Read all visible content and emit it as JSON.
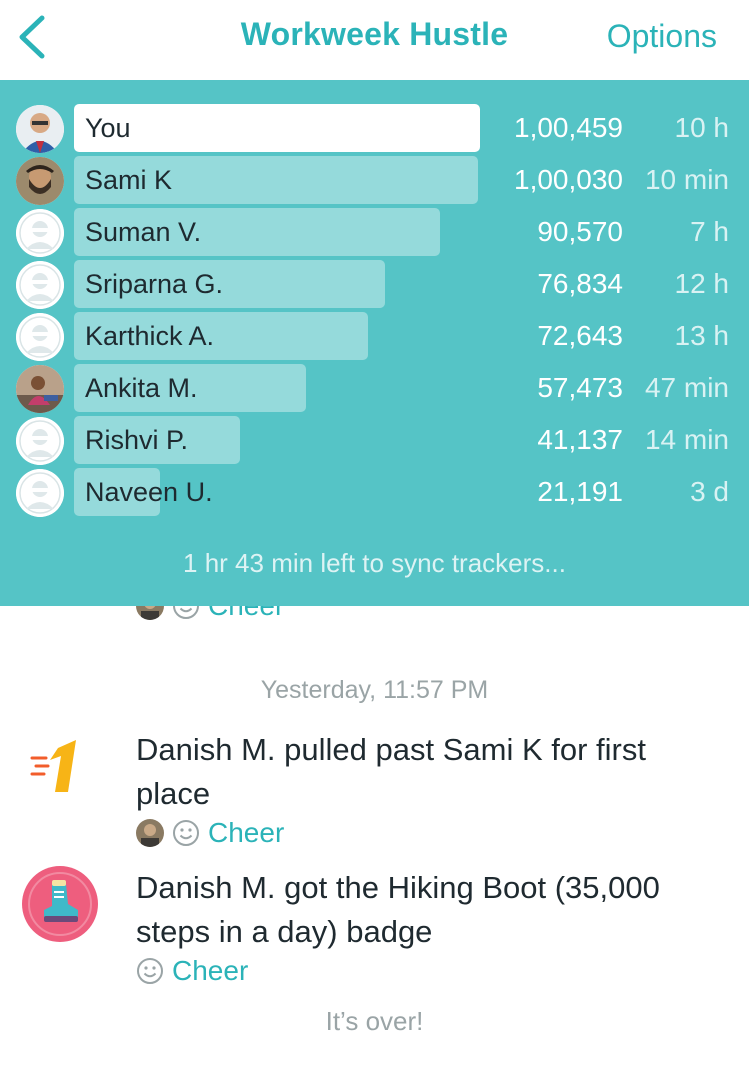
{
  "header": {
    "title": "Workweek Hustle",
    "options_label": "Options",
    "back_icon": "chevron-left-icon"
  },
  "leaderboard": {
    "rows": [
      {
        "name": "You",
        "steps": "1,00,459",
        "time": "10 h",
        "avatar": "photo-man-blue-suit",
        "share": 1.0
      },
      {
        "name": "Sami K",
        "steps": "1,00,030",
        "time": "10 min",
        "avatar": "photo-man-beard",
        "share": 0.9957
      },
      {
        "name": "Suman V.",
        "steps": "90,570",
        "time": "7 h",
        "avatar": "default-user-icon",
        "share": 0.9016
      },
      {
        "name": "Sriparna G.",
        "steps": "76,834",
        "time": "12 h",
        "avatar": "default-user-icon",
        "share": 0.7648
      },
      {
        "name": "Karthick A.",
        "steps": "72,643",
        "time": "13 h",
        "avatar": "default-user-icon",
        "share": 0.7231
      },
      {
        "name": "Ankita M.",
        "steps": "57,473",
        "time": "47 min",
        "avatar": "photo-woman-outdoor",
        "share": 0.5721
      },
      {
        "name": "Rishvi P.",
        "steps": "41,137",
        "time": "14 min",
        "avatar": "default-user-icon",
        "share": 0.4095
      },
      {
        "name": "Naveen U.",
        "steps": "21,191",
        "time": "3 d",
        "avatar": "default-user-icon",
        "share": 0.2109
      }
    ],
    "sync_text": "1 hr 43 min left to sync trackers..."
  },
  "feed": {
    "partial_cheer": "Cheer",
    "timestamp": "Yesterday, 11:57 PM",
    "items": [
      {
        "icon": "first-place-icon",
        "text": "Danish M. pulled past Sami K for first place",
        "cheer_label": "Cheer",
        "has_cheer_avatar": true
      },
      {
        "icon": "hiking-boot-badge-icon",
        "text": "Danish M. got the Hiking Boot (35,000 steps in a day) badge",
        "cheer_label": "Cheer",
        "has_cheer_avatar": false
      }
    ],
    "end_text": "It’s over!"
  },
  "colors": {
    "accent": "#2bb3b8",
    "panel": "#55c4c6",
    "first_place": "#f7b416",
    "first_place_lines": "#f25d2b",
    "badge_bg": "#ee5e7e"
  }
}
